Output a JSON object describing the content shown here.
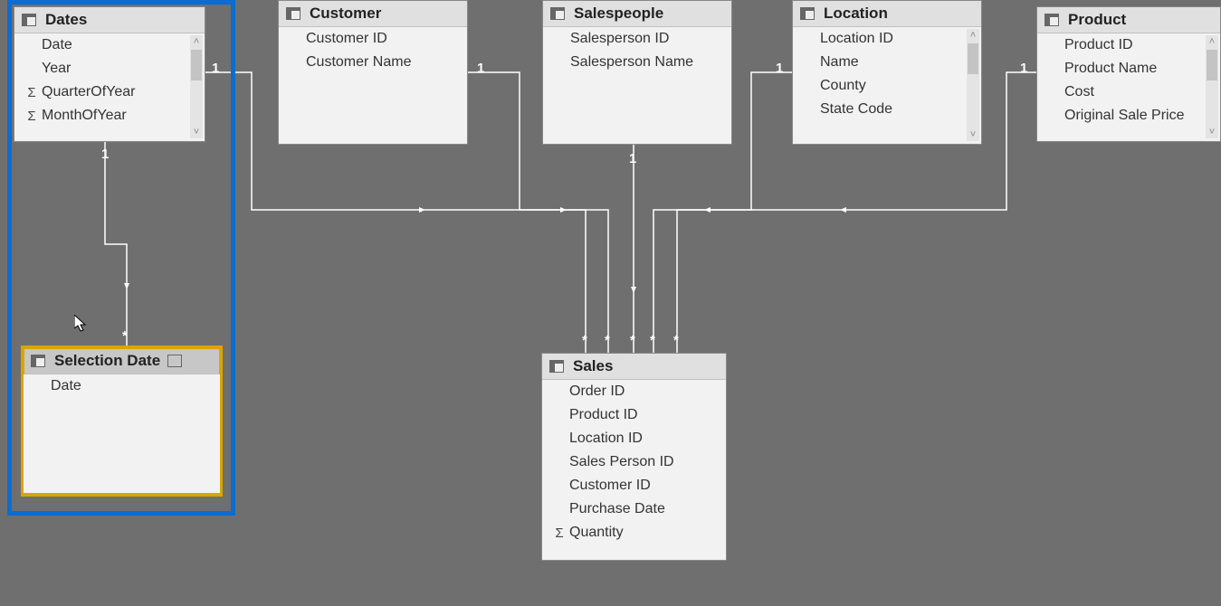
{
  "tables": {
    "dates": {
      "title": "Dates",
      "fields": [
        {
          "name": "Date",
          "sigma": false
        },
        {
          "name": "Year",
          "sigma": false
        },
        {
          "name": "QuarterOfYear",
          "sigma": true
        },
        {
          "name": "MonthOfYear",
          "sigma": true
        }
      ]
    },
    "customer": {
      "title": "Customer",
      "fields": [
        {
          "name": "Customer ID",
          "sigma": false
        },
        {
          "name": "Customer Name",
          "sigma": false
        }
      ]
    },
    "salespeople": {
      "title": "Salespeople",
      "fields": [
        {
          "name": "Salesperson ID",
          "sigma": false
        },
        {
          "name": "Salesperson Name",
          "sigma": false
        }
      ]
    },
    "location": {
      "title": "Location",
      "fields": [
        {
          "name": "Location ID",
          "sigma": false
        },
        {
          "name": "Name",
          "sigma": false
        },
        {
          "name": "County",
          "sigma": false
        },
        {
          "name": "State Code",
          "sigma": false
        }
      ]
    },
    "product": {
      "title": "Product",
      "fields": [
        {
          "name": "Product ID",
          "sigma": false
        },
        {
          "name": "Product Name",
          "sigma": false
        },
        {
          "name": "Cost",
          "sigma": false
        },
        {
          "name": "Original Sale Price",
          "sigma": false
        }
      ]
    },
    "selection_date": {
      "title": "Selection Date",
      "fields": [
        {
          "name": "Date",
          "sigma": false
        }
      ]
    },
    "sales": {
      "title": "Sales",
      "fields": [
        {
          "name": "Order ID",
          "sigma": false
        },
        {
          "name": "Product ID",
          "sigma": false
        },
        {
          "name": "Location ID",
          "sigma": false
        },
        {
          "name": "Sales Person ID",
          "sigma": false
        },
        {
          "name": "Customer ID",
          "sigma": false
        },
        {
          "name": "Purchase Date",
          "sigma": false
        },
        {
          "name": "Quantity",
          "sigma": true
        }
      ]
    }
  },
  "cardinality": {
    "one": "1",
    "many": "*"
  },
  "relationships": [
    {
      "from": "dates",
      "to": "selection_date",
      "from_card": "1",
      "to_card": "*"
    },
    {
      "from": "customer",
      "to": "sales",
      "from_card": "1",
      "to_card": "*"
    },
    {
      "from": "salespeople",
      "to": "sales",
      "from_card": "1",
      "to_card": "*"
    },
    {
      "from": "location",
      "to": "sales",
      "from_card": "1",
      "to_card": "*"
    },
    {
      "from": "product",
      "to": "sales",
      "from_card": "1",
      "to_card": "*"
    },
    {
      "from": "dates",
      "to": "sales",
      "from_card": "1",
      "to_card": "*"
    }
  ]
}
